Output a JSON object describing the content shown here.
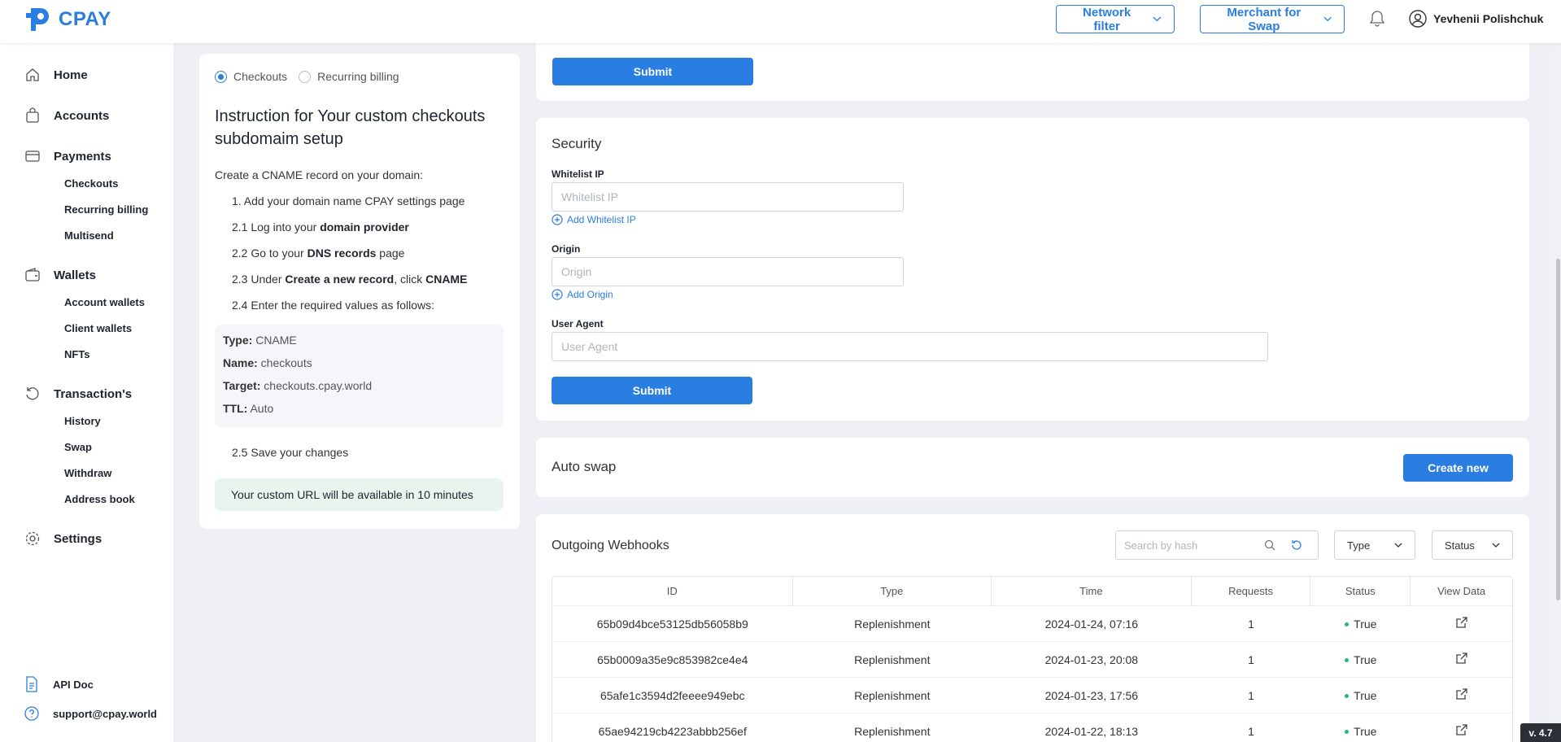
{
  "header": {
    "logo_text": "CPAY",
    "network_filter": "Network filter",
    "merchant_for_swap": "Merchant for Swap",
    "user_name": "Yevhenii Polishchuk"
  },
  "sidebar": {
    "home": "Home",
    "accounts": "Accounts",
    "payments": "Payments",
    "payments_sub": [
      "Checkouts",
      "Recurring billing",
      "Multisend"
    ],
    "wallets": "Wallets",
    "wallets_sub": [
      "Account wallets",
      "Client wallets",
      "NFTs"
    ],
    "transactions": "Transaction's",
    "transactions_sub": [
      "History",
      "Swap",
      "Withdraw",
      "Address book"
    ],
    "settings": "Settings",
    "api_doc": "API Doc",
    "support": "support@cpay.world"
  },
  "instructions": {
    "tab_checkouts": "Checkouts",
    "tab_recurring": "Recurring billing",
    "title": "Instruction for Your custom checkouts subdomaim setup",
    "intro": "Create a CNAME record on your domain:",
    "step1": "1. Add your domain name CPAY settings page",
    "step21_pre": "2.1 Log into your ",
    "step21_bold": "domain provider",
    "step22_pre": "2.2 Go to your ",
    "step22_bold": "DNS records",
    "step22_post": " page",
    "step23_pre": "2.3 Under ",
    "step23_bold": "Create a new record",
    "step23_mid": ", click ",
    "step23_bold2": "CNAME",
    "step24": "2.4 Enter the required values as follows:",
    "record": {
      "type_label": "Type:",
      "type_value": " CNAME",
      "name_label": "Name:",
      "name_value": " checkouts",
      "target_label": "Target:",
      "target_value": " checkouts.cpay.world",
      "ttl_label": "TTL:",
      "ttl_value": " Auto"
    },
    "step25": "2.5 Save your changes",
    "notice": "Your custom URL will be available in 10 minutes"
  },
  "top_section": {
    "submit": "Submit"
  },
  "security": {
    "title": "Security",
    "whitelist_label": "Whitelist IP",
    "whitelist_placeholder": "Whitelist IP",
    "add_whitelist": "Add Whitelist IP",
    "origin_label": "Origin",
    "origin_placeholder": "Origin",
    "add_origin": "Add Origin",
    "user_agent_label": "User Agent",
    "user_agent_placeholder": "User Agent",
    "submit": "Submit"
  },
  "auto_swap": {
    "title": "Auto swap",
    "create_new": "Create new"
  },
  "webhooks": {
    "title": "Outgoing Webhooks",
    "search_placeholder": "Search by hash",
    "type_filter": "Type",
    "status_filter": "Status",
    "columns": [
      "ID",
      "Type",
      "Time",
      "Requests",
      "Status",
      "View Data"
    ],
    "rows": [
      {
        "id": "65b09d4bce53125db56058b9",
        "type": "Replenishment",
        "time": "2024-01-24, 07:16",
        "requests": "1",
        "status": "True"
      },
      {
        "id": "65b0009a35e9c853982ce4e4",
        "type": "Replenishment",
        "time": "2024-01-23, 20:08",
        "requests": "1",
        "status": "True"
      },
      {
        "id": "65afe1c3594d2feeee949ebc",
        "type": "Replenishment",
        "time": "2024-01-23, 17:56",
        "requests": "1",
        "status": "True"
      },
      {
        "id": "65ae94219cb4223abbb256ef",
        "type": "Replenishment",
        "time": "2024-01-22, 18:13",
        "requests": "1",
        "status": "True"
      }
    ]
  },
  "version": "v. 4.7",
  "colors": {
    "accent": "#2a7de1",
    "success": "#2bb673",
    "notice_bg": "#e7f5ee"
  }
}
